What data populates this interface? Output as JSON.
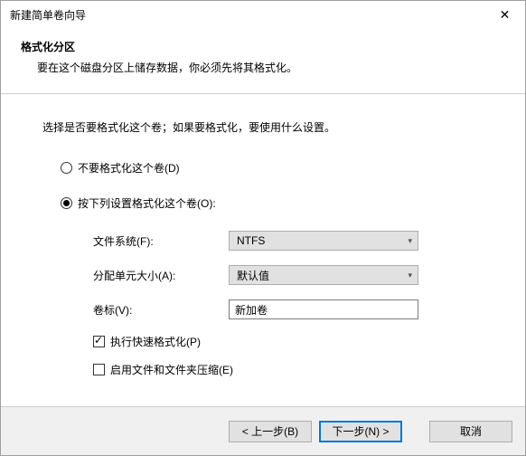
{
  "titlebar": {
    "title": "新建简单卷向导"
  },
  "header": {
    "title": "格式化分区",
    "subtitle": "要在这个磁盘分区上储存数据，你必须先将其格式化。"
  },
  "instruction": "选择是否要格式化这个卷；如果要格式化，要使用什么设置。",
  "radios": {
    "noformat": "不要格式化这个卷(D)",
    "format": "按下列设置格式化这个卷(O):"
  },
  "form": {
    "fs_label": "文件系统(F):",
    "fs_value": "NTFS",
    "alloc_label": "分配单元大小(A):",
    "alloc_value": "默认值",
    "volume_label_label": "卷标(V):",
    "volume_label_value": "新加卷"
  },
  "checks": {
    "quick": "执行快速格式化(P)",
    "compress": "启用文件和文件夹压缩(E)"
  },
  "buttons": {
    "back": "< 上一步(B)",
    "next": "下一步(N) >",
    "cancel": "取消"
  }
}
